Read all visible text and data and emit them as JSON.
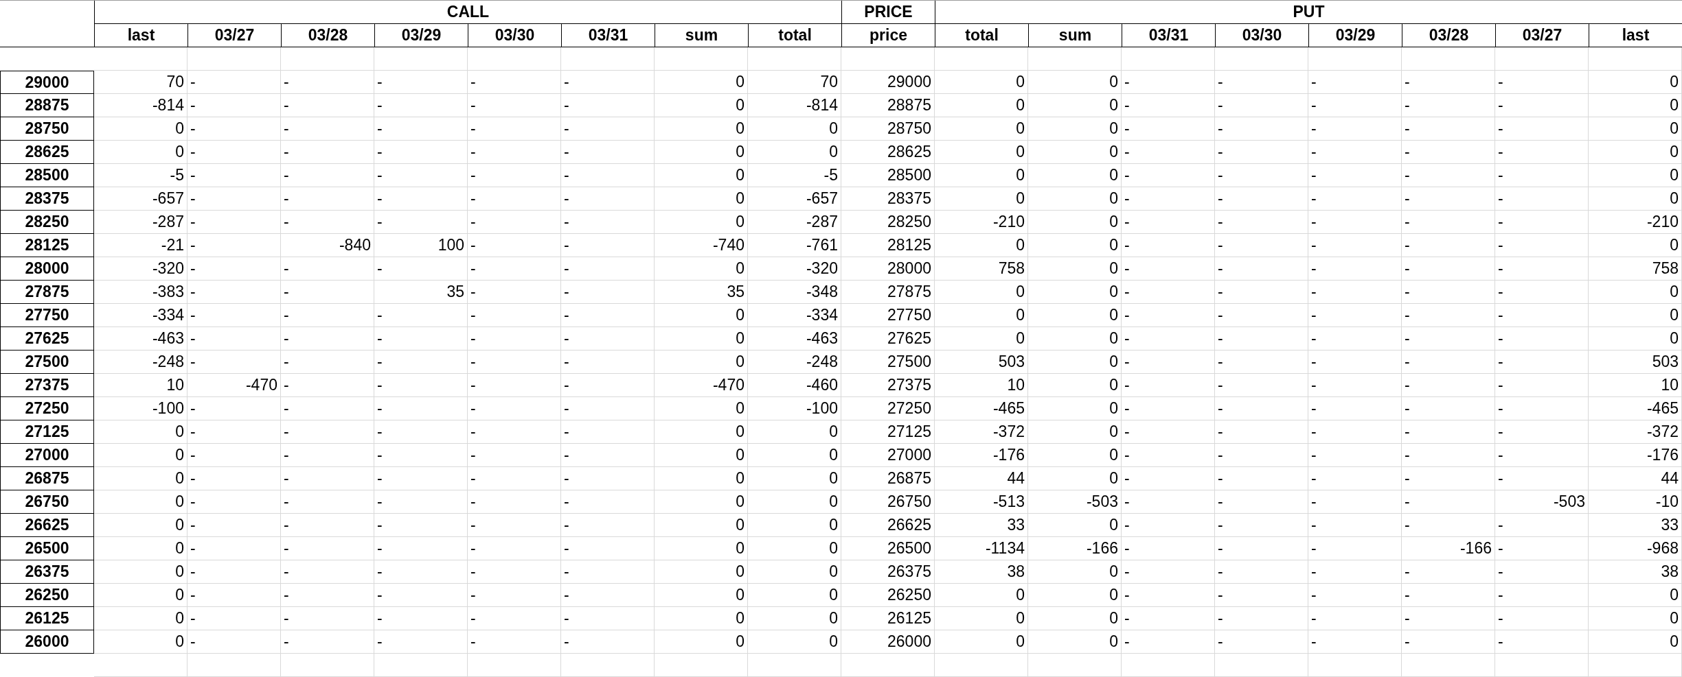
{
  "groups": [
    {
      "label": "CALL",
      "columns": [
        "last",
        "03/27",
        "03/28",
        "03/29",
        "03/30",
        "03/31",
        "sum",
        "total"
      ]
    },
    {
      "label": "PRICE",
      "columns": [
        "price"
      ]
    },
    {
      "label": "PUT",
      "columns": [
        "total",
        "sum",
        "03/31",
        "03/30",
        "03/29",
        "03/28",
        "03/27",
        "last"
      ]
    }
  ],
  "rows": [
    {
      "strike": "29000",
      "cells": [
        {
          "text": "70",
          "kind": "number"
        },
        {
          "text": "-",
          "kind": "dash"
        },
        {
          "text": "-",
          "kind": "dash"
        },
        {
          "text": "-",
          "kind": "dash"
        },
        {
          "text": "-",
          "kind": "dash"
        },
        {
          "text": "-",
          "kind": "dash"
        },
        {
          "text": "0",
          "kind": "number"
        },
        {
          "text": "70",
          "kind": "number"
        },
        {
          "text": "29000",
          "kind": "number"
        },
        {
          "text": "0",
          "kind": "number"
        },
        {
          "text": "0",
          "kind": "number"
        },
        {
          "text": "-",
          "kind": "dash"
        },
        {
          "text": "-",
          "kind": "dash"
        },
        {
          "text": "-",
          "kind": "dash"
        },
        {
          "text": "-",
          "kind": "dash"
        },
        {
          "text": "-",
          "kind": "dash"
        },
        {
          "text": "0",
          "kind": "number"
        }
      ]
    },
    {
      "strike": "28875",
      "cells": [
        {
          "text": "-814",
          "kind": "number"
        },
        {
          "text": "-",
          "kind": "dash"
        },
        {
          "text": "-",
          "kind": "dash"
        },
        {
          "text": "-",
          "kind": "dash"
        },
        {
          "text": "-",
          "kind": "dash"
        },
        {
          "text": "-",
          "kind": "dash"
        },
        {
          "text": "0",
          "kind": "number"
        },
        {
          "text": "-814",
          "kind": "number"
        },
        {
          "text": "28875",
          "kind": "number"
        },
        {
          "text": "0",
          "kind": "number"
        },
        {
          "text": "0",
          "kind": "number"
        },
        {
          "text": "-",
          "kind": "dash"
        },
        {
          "text": "-",
          "kind": "dash"
        },
        {
          "text": "-",
          "kind": "dash"
        },
        {
          "text": "-",
          "kind": "dash"
        },
        {
          "text": "-",
          "kind": "dash"
        },
        {
          "text": "0",
          "kind": "number"
        }
      ]
    },
    {
      "strike": "28750",
      "cells": [
        {
          "text": "0",
          "kind": "number"
        },
        {
          "text": "-",
          "kind": "dash"
        },
        {
          "text": "-",
          "kind": "dash"
        },
        {
          "text": "-",
          "kind": "dash"
        },
        {
          "text": "-",
          "kind": "dash"
        },
        {
          "text": "-",
          "kind": "dash"
        },
        {
          "text": "0",
          "kind": "number"
        },
        {
          "text": "0",
          "kind": "number"
        },
        {
          "text": "28750",
          "kind": "number"
        },
        {
          "text": "0",
          "kind": "number"
        },
        {
          "text": "0",
          "kind": "number"
        },
        {
          "text": "-",
          "kind": "dash"
        },
        {
          "text": "-",
          "kind": "dash"
        },
        {
          "text": "-",
          "kind": "dash"
        },
        {
          "text": "-",
          "kind": "dash"
        },
        {
          "text": "-",
          "kind": "dash"
        },
        {
          "text": "0",
          "kind": "number"
        }
      ]
    },
    {
      "strike": "28625",
      "cells": [
        {
          "text": "0",
          "kind": "number"
        },
        {
          "text": "-",
          "kind": "dash"
        },
        {
          "text": "-",
          "kind": "dash"
        },
        {
          "text": "-",
          "kind": "dash"
        },
        {
          "text": "-",
          "kind": "dash"
        },
        {
          "text": "-",
          "kind": "dash"
        },
        {
          "text": "0",
          "kind": "number"
        },
        {
          "text": "0",
          "kind": "number"
        },
        {
          "text": "28625",
          "kind": "number"
        },
        {
          "text": "0",
          "kind": "number"
        },
        {
          "text": "0",
          "kind": "number"
        },
        {
          "text": "-",
          "kind": "dash"
        },
        {
          "text": "-",
          "kind": "dash"
        },
        {
          "text": "-",
          "kind": "dash"
        },
        {
          "text": "-",
          "kind": "dash"
        },
        {
          "text": "-",
          "kind": "dash"
        },
        {
          "text": "0",
          "kind": "number"
        }
      ]
    },
    {
      "strike": "28500",
      "cells": [
        {
          "text": "-5",
          "kind": "number"
        },
        {
          "text": "-",
          "kind": "dash"
        },
        {
          "text": "-",
          "kind": "dash"
        },
        {
          "text": "-",
          "kind": "dash"
        },
        {
          "text": "-",
          "kind": "dash"
        },
        {
          "text": "-",
          "kind": "dash"
        },
        {
          "text": "0",
          "kind": "number"
        },
        {
          "text": "-5",
          "kind": "number"
        },
        {
          "text": "28500",
          "kind": "number"
        },
        {
          "text": "0",
          "kind": "number"
        },
        {
          "text": "0",
          "kind": "number"
        },
        {
          "text": "-",
          "kind": "dash"
        },
        {
          "text": "-",
          "kind": "dash"
        },
        {
          "text": "-",
          "kind": "dash"
        },
        {
          "text": "-",
          "kind": "dash"
        },
        {
          "text": "-",
          "kind": "dash"
        },
        {
          "text": "0",
          "kind": "number"
        }
      ]
    },
    {
      "strike": "28375",
      "cells": [
        {
          "text": "-657",
          "kind": "number"
        },
        {
          "text": "-",
          "kind": "dash"
        },
        {
          "text": "-",
          "kind": "dash"
        },
        {
          "text": "-",
          "kind": "dash"
        },
        {
          "text": "-",
          "kind": "dash"
        },
        {
          "text": "-",
          "kind": "dash"
        },
        {
          "text": "0",
          "kind": "number"
        },
        {
          "text": "-657",
          "kind": "number"
        },
        {
          "text": "28375",
          "kind": "number"
        },
        {
          "text": "0",
          "kind": "number"
        },
        {
          "text": "0",
          "kind": "number"
        },
        {
          "text": "-",
          "kind": "dash"
        },
        {
          "text": "-",
          "kind": "dash"
        },
        {
          "text": "-",
          "kind": "dash"
        },
        {
          "text": "-",
          "kind": "dash"
        },
        {
          "text": "-",
          "kind": "dash"
        },
        {
          "text": "0",
          "kind": "number"
        }
      ]
    },
    {
      "strike": "28250",
      "cells": [
        {
          "text": "-287",
          "kind": "number"
        },
        {
          "text": "-",
          "kind": "dash"
        },
        {
          "text": "-",
          "kind": "dash"
        },
        {
          "text": "-",
          "kind": "dash"
        },
        {
          "text": "-",
          "kind": "dash"
        },
        {
          "text": "-",
          "kind": "dash"
        },
        {
          "text": "0",
          "kind": "number"
        },
        {
          "text": "-287",
          "kind": "number"
        },
        {
          "text": "28250",
          "kind": "number"
        },
        {
          "text": "-210",
          "kind": "number"
        },
        {
          "text": "0",
          "kind": "number"
        },
        {
          "text": "-",
          "kind": "dash"
        },
        {
          "text": "-",
          "kind": "dash"
        },
        {
          "text": "-",
          "kind": "dash"
        },
        {
          "text": "-",
          "kind": "dash"
        },
        {
          "text": "-",
          "kind": "dash"
        },
        {
          "text": "-210",
          "kind": "number"
        }
      ]
    },
    {
      "strike": "28125",
      "cells": [
        {
          "text": "-21",
          "kind": "number"
        },
        {
          "text": "-",
          "kind": "dash"
        },
        {
          "text": "-840",
          "kind": "number"
        },
        {
          "text": "100",
          "kind": "number"
        },
        {
          "text": "-",
          "kind": "dash"
        },
        {
          "text": "-",
          "kind": "dash"
        },
        {
          "text": "-740",
          "kind": "number"
        },
        {
          "text": "-761",
          "kind": "number"
        },
        {
          "text": "28125",
          "kind": "number"
        },
        {
          "text": "0",
          "kind": "number"
        },
        {
          "text": "0",
          "kind": "number"
        },
        {
          "text": "-",
          "kind": "dash"
        },
        {
          "text": "-",
          "kind": "dash"
        },
        {
          "text": "-",
          "kind": "dash"
        },
        {
          "text": "-",
          "kind": "dash"
        },
        {
          "text": "-",
          "kind": "dash"
        },
        {
          "text": "0",
          "kind": "number"
        }
      ]
    },
    {
      "strike": "28000",
      "cells": [
        {
          "text": "-320",
          "kind": "number"
        },
        {
          "text": "-",
          "kind": "dash"
        },
        {
          "text": "-",
          "kind": "dash"
        },
        {
          "text": "-",
          "kind": "dash"
        },
        {
          "text": "-",
          "kind": "dash"
        },
        {
          "text": "-",
          "kind": "dash"
        },
        {
          "text": "0",
          "kind": "number"
        },
        {
          "text": "-320",
          "kind": "number"
        },
        {
          "text": "28000",
          "kind": "number"
        },
        {
          "text": "758",
          "kind": "number"
        },
        {
          "text": "0",
          "kind": "number"
        },
        {
          "text": "-",
          "kind": "dash"
        },
        {
          "text": "-",
          "kind": "dash"
        },
        {
          "text": "-",
          "kind": "dash"
        },
        {
          "text": "-",
          "kind": "dash"
        },
        {
          "text": "-",
          "kind": "dash"
        },
        {
          "text": "758",
          "kind": "number"
        }
      ]
    },
    {
      "strike": "27875",
      "cells": [
        {
          "text": "-383",
          "kind": "number"
        },
        {
          "text": "-",
          "kind": "dash"
        },
        {
          "text": "-",
          "kind": "dash"
        },
        {
          "text": "35",
          "kind": "number"
        },
        {
          "text": "-",
          "kind": "dash"
        },
        {
          "text": "-",
          "kind": "dash"
        },
        {
          "text": "35",
          "kind": "number"
        },
        {
          "text": "-348",
          "kind": "number"
        },
        {
          "text": "27875",
          "kind": "number"
        },
        {
          "text": "0",
          "kind": "number"
        },
        {
          "text": "0",
          "kind": "number"
        },
        {
          "text": "-",
          "kind": "dash"
        },
        {
          "text": "-",
          "kind": "dash"
        },
        {
          "text": "-",
          "kind": "dash"
        },
        {
          "text": "-",
          "kind": "dash"
        },
        {
          "text": "-",
          "kind": "dash"
        },
        {
          "text": "0",
          "kind": "number"
        }
      ]
    },
    {
      "strike": "27750",
      "cells": [
        {
          "text": "-334",
          "kind": "number"
        },
        {
          "text": "-",
          "kind": "dash"
        },
        {
          "text": "-",
          "kind": "dash"
        },
        {
          "text": "-",
          "kind": "dash"
        },
        {
          "text": "-",
          "kind": "dash"
        },
        {
          "text": "-",
          "kind": "dash"
        },
        {
          "text": "0",
          "kind": "number"
        },
        {
          "text": "-334",
          "kind": "number"
        },
        {
          "text": "27750",
          "kind": "number"
        },
        {
          "text": "0",
          "kind": "number"
        },
        {
          "text": "0",
          "kind": "number"
        },
        {
          "text": "-",
          "kind": "dash"
        },
        {
          "text": "-",
          "kind": "dash"
        },
        {
          "text": "-",
          "kind": "dash"
        },
        {
          "text": "-",
          "kind": "dash"
        },
        {
          "text": "-",
          "kind": "dash"
        },
        {
          "text": "0",
          "kind": "number"
        }
      ]
    },
    {
      "strike": "27625",
      "cells": [
        {
          "text": "-463",
          "kind": "number"
        },
        {
          "text": "-",
          "kind": "dash"
        },
        {
          "text": "-",
          "kind": "dash"
        },
        {
          "text": "-",
          "kind": "dash"
        },
        {
          "text": "-",
          "kind": "dash"
        },
        {
          "text": "-",
          "kind": "dash"
        },
        {
          "text": "0",
          "kind": "number"
        },
        {
          "text": "-463",
          "kind": "number"
        },
        {
          "text": "27625",
          "kind": "number"
        },
        {
          "text": "0",
          "kind": "number"
        },
        {
          "text": "0",
          "kind": "number"
        },
        {
          "text": "-",
          "kind": "dash"
        },
        {
          "text": "-",
          "kind": "dash"
        },
        {
          "text": "-",
          "kind": "dash"
        },
        {
          "text": "-",
          "kind": "dash"
        },
        {
          "text": "-",
          "kind": "dash"
        },
        {
          "text": "0",
          "kind": "number"
        }
      ]
    },
    {
      "strike": "27500",
      "cells": [
        {
          "text": "-248",
          "kind": "number"
        },
        {
          "text": "-",
          "kind": "dash"
        },
        {
          "text": "-",
          "kind": "dash"
        },
        {
          "text": "-",
          "kind": "dash"
        },
        {
          "text": "-",
          "kind": "dash"
        },
        {
          "text": "-",
          "kind": "dash"
        },
        {
          "text": "0",
          "kind": "number"
        },
        {
          "text": "-248",
          "kind": "number"
        },
        {
          "text": "27500",
          "kind": "number"
        },
        {
          "text": "503",
          "kind": "number"
        },
        {
          "text": "0",
          "kind": "number"
        },
        {
          "text": "-",
          "kind": "dash"
        },
        {
          "text": "-",
          "kind": "dash"
        },
        {
          "text": "-",
          "kind": "dash"
        },
        {
          "text": "-",
          "kind": "dash"
        },
        {
          "text": "-",
          "kind": "dash"
        },
        {
          "text": "503",
          "kind": "number"
        }
      ]
    },
    {
      "strike": "27375",
      "cells": [
        {
          "text": "10",
          "kind": "number"
        },
        {
          "text": "-470",
          "kind": "number"
        },
        {
          "text": "-",
          "kind": "dash"
        },
        {
          "text": "-",
          "kind": "dash"
        },
        {
          "text": "-",
          "kind": "dash"
        },
        {
          "text": "-",
          "kind": "dash"
        },
        {
          "text": "-470",
          "kind": "number"
        },
        {
          "text": "-460",
          "kind": "number"
        },
        {
          "text": "27375",
          "kind": "number"
        },
        {
          "text": "10",
          "kind": "number"
        },
        {
          "text": "0",
          "kind": "number"
        },
        {
          "text": "-",
          "kind": "dash"
        },
        {
          "text": "-",
          "kind": "dash"
        },
        {
          "text": "-",
          "kind": "dash"
        },
        {
          "text": "-",
          "kind": "dash"
        },
        {
          "text": "-",
          "kind": "dash"
        },
        {
          "text": "10",
          "kind": "number"
        }
      ]
    },
    {
      "strike": "27250",
      "cells": [
        {
          "text": "-100",
          "kind": "number"
        },
        {
          "text": "-",
          "kind": "dash"
        },
        {
          "text": "-",
          "kind": "dash"
        },
        {
          "text": "-",
          "kind": "dash"
        },
        {
          "text": "-",
          "kind": "dash"
        },
        {
          "text": "-",
          "kind": "dash"
        },
        {
          "text": "0",
          "kind": "number"
        },
        {
          "text": "-100",
          "kind": "number"
        },
        {
          "text": "27250",
          "kind": "number"
        },
        {
          "text": "-465",
          "kind": "number"
        },
        {
          "text": "0",
          "kind": "number"
        },
        {
          "text": "-",
          "kind": "dash"
        },
        {
          "text": "-",
          "kind": "dash"
        },
        {
          "text": "-",
          "kind": "dash"
        },
        {
          "text": "-",
          "kind": "dash"
        },
        {
          "text": "-",
          "kind": "dash"
        },
        {
          "text": "-465",
          "kind": "number"
        }
      ]
    },
    {
      "strike": "27125",
      "cells": [
        {
          "text": "0",
          "kind": "number"
        },
        {
          "text": "-",
          "kind": "dash"
        },
        {
          "text": "-",
          "kind": "dash"
        },
        {
          "text": "-",
          "kind": "dash"
        },
        {
          "text": "-",
          "kind": "dash"
        },
        {
          "text": "-",
          "kind": "dash"
        },
        {
          "text": "0",
          "kind": "number"
        },
        {
          "text": "0",
          "kind": "number"
        },
        {
          "text": "27125",
          "kind": "number"
        },
        {
          "text": "-372",
          "kind": "number"
        },
        {
          "text": "0",
          "kind": "number"
        },
        {
          "text": "-",
          "kind": "dash"
        },
        {
          "text": "-",
          "kind": "dash"
        },
        {
          "text": "-",
          "kind": "dash"
        },
        {
          "text": "-",
          "kind": "dash"
        },
        {
          "text": "-",
          "kind": "dash"
        },
        {
          "text": "-372",
          "kind": "number"
        }
      ]
    },
    {
      "strike": "27000",
      "cells": [
        {
          "text": "0",
          "kind": "number"
        },
        {
          "text": "-",
          "kind": "dash"
        },
        {
          "text": "-",
          "kind": "dash"
        },
        {
          "text": "-",
          "kind": "dash"
        },
        {
          "text": "-",
          "kind": "dash"
        },
        {
          "text": "-",
          "kind": "dash"
        },
        {
          "text": "0",
          "kind": "number"
        },
        {
          "text": "0",
          "kind": "number"
        },
        {
          "text": "27000",
          "kind": "number"
        },
        {
          "text": "-176",
          "kind": "number"
        },
        {
          "text": "0",
          "kind": "number"
        },
        {
          "text": "-",
          "kind": "dash"
        },
        {
          "text": "-",
          "kind": "dash"
        },
        {
          "text": "-",
          "kind": "dash"
        },
        {
          "text": "-",
          "kind": "dash"
        },
        {
          "text": "-",
          "kind": "dash"
        },
        {
          "text": "-176",
          "kind": "number"
        }
      ]
    },
    {
      "strike": "26875",
      "cells": [
        {
          "text": "0",
          "kind": "number"
        },
        {
          "text": "-",
          "kind": "dash"
        },
        {
          "text": "-",
          "kind": "dash"
        },
        {
          "text": "-",
          "kind": "dash"
        },
        {
          "text": "-",
          "kind": "dash"
        },
        {
          "text": "-",
          "kind": "dash"
        },
        {
          "text": "0",
          "kind": "number"
        },
        {
          "text": "0",
          "kind": "number"
        },
        {
          "text": "26875",
          "kind": "number"
        },
        {
          "text": "44",
          "kind": "number"
        },
        {
          "text": "0",
          "kind": "number"
        },
        {
          "text": "-",
          "kind": "dash"
        },
        {
          "text": "-",
          "kind": "dash"
        },
        {
          "text": "-",
          "kind": "dash"
        },
        {
          "text": "-",
          "kind": "dash"
        },
        {
          "text": "-",
          "kind": "dash"
        },
        {
          "text": "44",
          "kind": "number"
        }
      ]
    },
    {
      "strike": "26750",
      "cells": [
        {
          "text": "0",
          "kind": "number"
        },
        {
          "text": "-",
          "kind": "dash"
        },
        {
          "text": "-",
          "kind": "dash"
        },
        {
          "text": "-",
          "kind": "dash"
        },
        {
          "text": "-",
          "kind": "dash"
        },
        {
          "text": "-",
          "kind": "dash"
        },
        {
          "text": "0",
          "kind": "number"
        },
        {
          "text": "0",
          "kind": "number"
        },
        {
          "text": "26750",
          "kind": "number"
        },
        {
          "text": "-513",
          "kind": "number"
        },
        {
          "text": "-503",
          "kind": "number"
        },
        {
          "text": "-",
          "kind": "dash"
        },
        {
          "text": "-",
          "kind": "dash"
        },
        {
          "text": "-",
          "kind": "dash"
        },
        {
          "text": "-",
          "kind": "dash"
        },
        {
          "text": "-503",
          "kind": "number"
        },
        {
          "text": "-10",
          "kind": "number"
        }
      ]
    },
    {
      "strike": "26625",
      "cells": [
        {
          "text": "0",
          "kind": "number"
        },
        {
          "text": "-",
          "kind": "dash"
        },
        {
          "text": "-",
          "kind": "dash"
        },
        {
          "text": "-",
          "kind": "dash"
        },
        {
          "text": "-",
          "kind": "dash"
        },
        {
          "text": "-",
          "kind": "dash"
        },
        {
          "text": "0",
          "kind": "number"
        },
        {
          "text": "0",
          "kind": "number"
        },
        {
          "text": "26625",
          "kind": "number"
        },
        {
          "text": "33",
          "kind": "number"
        },
        {
          "text": "0",
          "kind": "number"
        },
        {
          "text": "-",
          "kind": "dash"
        },
        {
          "text": "-",
          "kind": "dash"
        },
        {
          "text": "-",
          "kind": "dash"
        },
        {
          "text": "-",
          "kind": "dash"
        },
        {
          "text": "-",
          "kind": "dash"
        },
        {
          "text": "33",
          "kind": "number"
        }
      ]
    },
    {
      "strike": "26500",
      "cells": [
        {
          "text": "0",
          "kind": "number"
        },
        {
          "text": "-",
          "kind": "dash"
        },
        {
          "text": "-",
          "kind": "dash"
        },
        {
          "text": "-",
          "kind": "dash"
        },
        {
          "text": "-",
          "kind": "dash"
        },
        {
          "text": "-",
          "kind": "dash"
        },
        {
          "text": "0",
          "kind": "number"
        },
        {
          "text": "0",
          "kind": "number"
        },
        {
          "text": "26500",
          "kind": "number"
        },
        {
          "text": "-1134",
          "kind": "number"
        },
        {
          "text": "-166",
          "kind": "number"
        },
        {
          "text": "-",
          "kind": "dash"
        },
        {
          "text": "-",
          "kind": "dash"
        },
        {
          "text": "-",
          "kind": "dash"
        },
        {
          "text": "-166",
          "kind": "number"
        },
        {
          "text": "-",
          "kind": "dash"
        },
        {
          "text": "-968",
          "kind": "number"
        }
      ]
    },
    {
      "strike": "26375",
      "cells": [
        {
          "text": "0",
          "kind": "number"
        },
        {
          "text": "-",
          "kind": "dash"
        },
        {
          "text": "-",
          "kind": "dash"
        },
        {
          "text": "-",
          "kind": "dash"
        },
        {
          "text": "-",
          "kind": "dash"
        },
        {
          "text": "-",
          "kind": "dash"
        },
        {
          "text": "0",
          "kind": "number"
        },
        {
          "text": "0",
          "kind": "number"
        },
        {
          "text": "26375",
          "kind": "number"
        },
        {
          "text": "38",
          "kind": "number"
        },
        {
          "text": "0",
          "kind": "number"
        },
        {
          "text": "-",
          "kind": "dash"
        },
        {
          "text": "-",
          "kind": "dash"
        },
        {
          "text": "-",
          "kind": "dash"
        },
        {
          "text": "-",
          "kind": "dash"
        },
        {
          "text": "-",
          "kind": "dash"
        },
        {
          "text": "38",
          "kind": "number"
        }
      ]
    },
    {
      "strike": "26250",
      "cells": [
        {
          "text": "0",
          "kind": "number"
        },
        {
          "text": "-",
          "kind": "dash"
        },
        {
          "text": "-",
          "kind": "dash"
        },
        {
          "text": "-",
          "kind": "dash"
        },
        {
          "text": "-",
          "kind": "dash"
        },
        {
          "text": "-",
          "kind": "dash"
        },
        {
          "text": "0",
          "kind": "number"
        },
        {
          "text": "0",
          "kind": "number"
        },
        {
          "text": "26250",
          "kind": "number"
        },
        {
          "text": "0",
          "kind": "number"
        },
        {
          "text": "0",
          "kind": "number"
        },
        {
          "text": "-",
          "kind": "dash"
        },
        {
          "text": "-",
          "kind": "dash"
        },
        {
          "text": "-",
          "kind": "dash"
        },
        {
          "text": "-",
          "kind": "dash"
        },
        {
          "text": "-",
          "kind": "dash"
        },
        {
          "text": "0",
          "kind": "number"
        }
      ]
    },
    {
      "strike": "26125",
      "cells": [
        {
          "text": "0",
          "kind": "number"
        },
        {
          "text": "-",
          "kind": "dash"
        },
        {
          "text": "-",
          "kind": "dash"
        },
        {
          "text": "-",
          "kind": "dash"
        },
        {
          "text": "-",
          "kind": "dash"
        },
        {
          "text": "-",
          "kind": "dash"
        },
        {
          "text": "0",
          "kind": "number"
        },
        {
          "text": "0",
          "kind": "number"
        },
        {
          "text": "26125",
          "kind": "number"
        },
        {
          "text": "0",
          "kind": "number"
        },
        {
          "text": "0",
          "kind": "number"
        },
        {
          "text": "-",
          "kind": "dash"
        },
        {
          "text": "-",
          "kind": "dash"
        },
        {
          "text": "-",
          "kind": "dash"
        },
        {
          "text": "-",
          "kind": "dash"
        },
        {
          "text": "-",
          "kind": "dash"
        },
        {
          "text": "0",
          "kind": "number"
        }
      ]
    },
    {
      "strike": "26000",
      "cells": [
        {
          "text": "0",
          "kind": "number"
        },
        {
          "text": "-",
          "kind": "dash"
        },
        {
          "text": "-",
          "kind": "dash"
        },
        {
          "text": "-",
          "kind": "dash"
        },
        {
          "text": "-",
          "kind": "dash"
        },
        {
          "text": "-",
          "kind": "dash"
        },
        {
          "text": "0",
          "kind": "number"
        },
        {
          "text": "0",
          "kind": "number"
        },
        {
          "text": "26000",
          "kind": "number"
        },
        {
          "text": "0",
          "kind": "number"
        },
        {
          "text": "0",
          "kind": "number"
        },
        {
          "text": "-",
          "kind": "dash"
        },
        {
          "text": "-",
          "kind": "dash"
        },
        {
          "text": "-",
          "kind": "dash"
        },
        {
          "text": "-",
          "kind": "dash"
        },
        {
          "text": "-",
          "kind": "dash"
        },
        {
          "text": "0",
          "kind": "number"
        }
      ]
    }
  ]
}
